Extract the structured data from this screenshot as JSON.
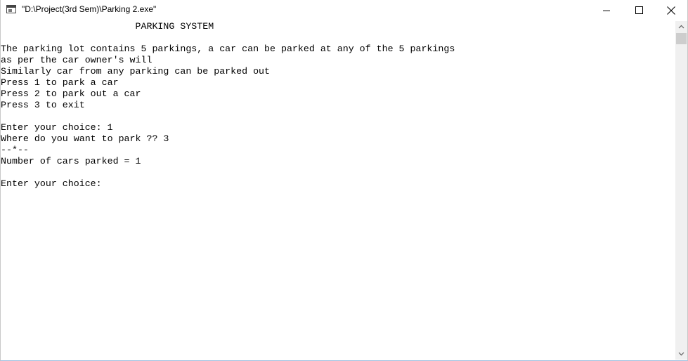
{
  "window": {
    "title": "\"D:\\Project(3rd Sem)\\Parking 2.exe\""
  },
  "console": {
    "lines": [
      "                        PARKING SYSTEM",
      "",
      "The parking lot contains 5 parkings, a car can be parked at any of the 5 parkings",
      "as per the car owner's will",
      "Similarly car from any parking can be parked out",
      "Press 1 to park a car",
      "Press 2 to park out a car",
      "Press 3 to exit",
      "",
      "Enter your choice: 1",
      "Where do you want to park ?? 3",
      "--*--",
      "Number of cars parked = 1",
      "",
      "Enter your choice:"
    ]
  },
  "icons": {
    "app": "console-app-icon",
    "minimize": "minimize-icon",
    "maximize": "maximize-icon",
    "close": "close-icon",
    "scroll_up": "chevron-up-icon",
    "scroll_down": "chevron-down-icon"
  }
}
